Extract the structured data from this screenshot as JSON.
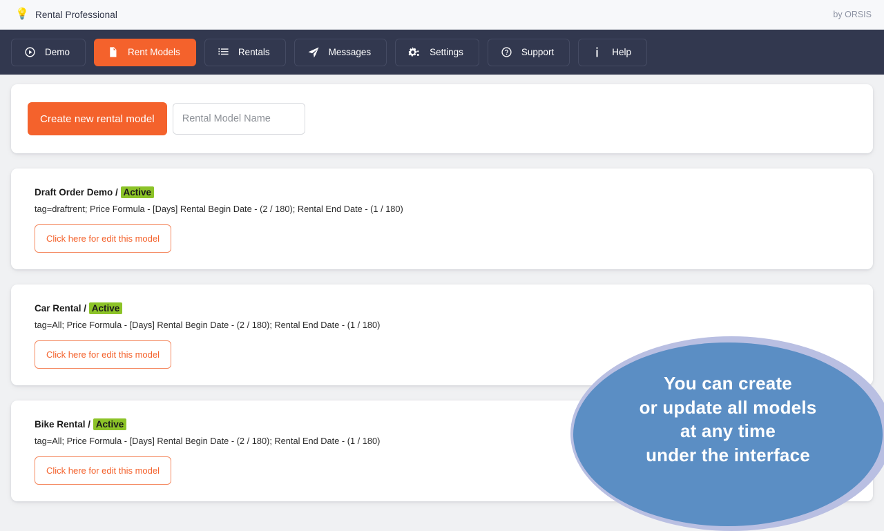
{
  "topbar": {
    "brand_icon": "lightbulb-icon",
    "title": "Rental Professional",
    "byline": "by ORSIS"
  },
  "nav": {
    "items": [
      {
        "label": "Demo",
        "icon": "play-circle-icon",
        "active": false
      },
      {
        "label": "Rent Models",
        "icon": "document-icon",
        "active": true
      },
      {
        "label": "Rentals",
        "icon": "list-icon",
        "active": false
      },
      {
        "label": "Messages",
        "icon": "paper-plane-icon",
        "active": false
      },
      {
        "label": "Settings",
        "icon": "gears-icon",
        "active": false
      },
      {
        "label": "Support",
        "icon": "question-circle-icon",
        "active": false
      },
      {
        "label": "Help",
        "icon": "info-icon",
        "active": false
      }
    ]
  },
  "create_panel": {
    "button_label": "Create new rental model",
    "input_placeholder": "Rental Model Name",
    "input_value": ""
  },
  "models": [
    {
      "name": "Draft Order Demo",
      "separator": " / ",
      "status": "Active",
      "description": "tag=draftrent; Price Formula - [Days] Rental Begin Date - (2 / 180); Rental End Date - (1 / 180)",
      "edit_label": "Click here for edit this model"
    },
    {
      "name": "Car Rental",
      "separator": " / ",
      "status": "Active",
      "description": "tag=All; Price Formula - [Days] Rental Begin Date - (2 / 180); Rental End Date - (1 / 180)",
      "edit_label": "Click here for edit this model"
    },
    {
      "name": "Bike Rental",
      "separator": " / ",
      "status": "Active",
      "description": "tag=All; Price Formula - [Days] Rental Begin Date - (2 / 180); Rental End Date - (1 / 180)",
      "edit_label": "Click here for edit this model"
    }
  ],
  "callout": {
    "text": "You can create\nor update all models\nat any time\nunder the interface"
  },
  "colors": {
    "accent_orange": "#f4622c",
    "nav_dark": "#32384f",
    "badge_green": "#8cc328",
    "callout_blue": "#5b8ec4",
    "callout_ring": "#b9bfe2",
    "page_bg": "#f0f1f3"
  }
}
